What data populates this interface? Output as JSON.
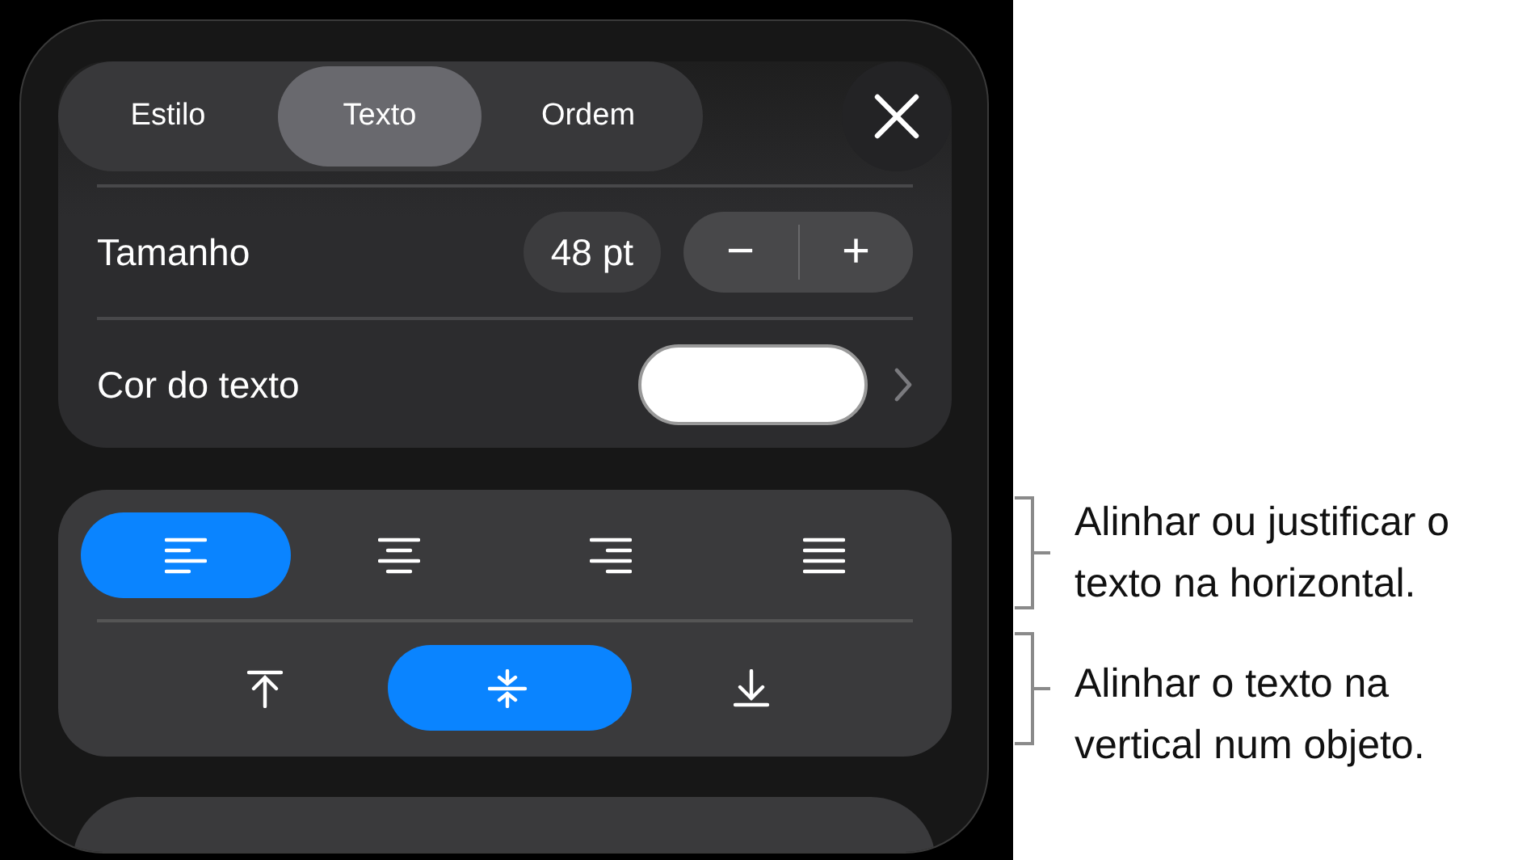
{
  "tabs": [
    {
      "label": "Estilo",
      "selected": false
    },
    {
      "label": "Texto",
      "selected": true
    },
    {
      "label": "Ordem",
      "selected": false
    }
  ],
  "size": {
    "label": "Tamanho",
    "value": "48 pt",
    "decrease": "−",
    "increase": "+"
  },
  "text_color": {
    "label": "Cor do texto"
  },
  "horizontal_alignment": [
    {
      "kind": "left",
      "selected": true
    },
    {
      "kind": "center",
      "selected": false
    },
    {
      "kind": "right",
      "selected": false
    },
    {
      "kind": "justify",
      "selected": false
    }
  ],
  "vertical_alignment": [
    {
      "kind": "top",
      "selected": false
    },
    {
      "kind": "middle",
      "selected": true
    },
    {
      "kind": "bottom",
      "selected": false
    }
  ],
  "callouts": [
    {
      "text": "Alinhar ou justificar o texto na horizontal."
    },
    {
      "text": "Alinhar o texto na vertical num objeto."
    }
  ]
}
